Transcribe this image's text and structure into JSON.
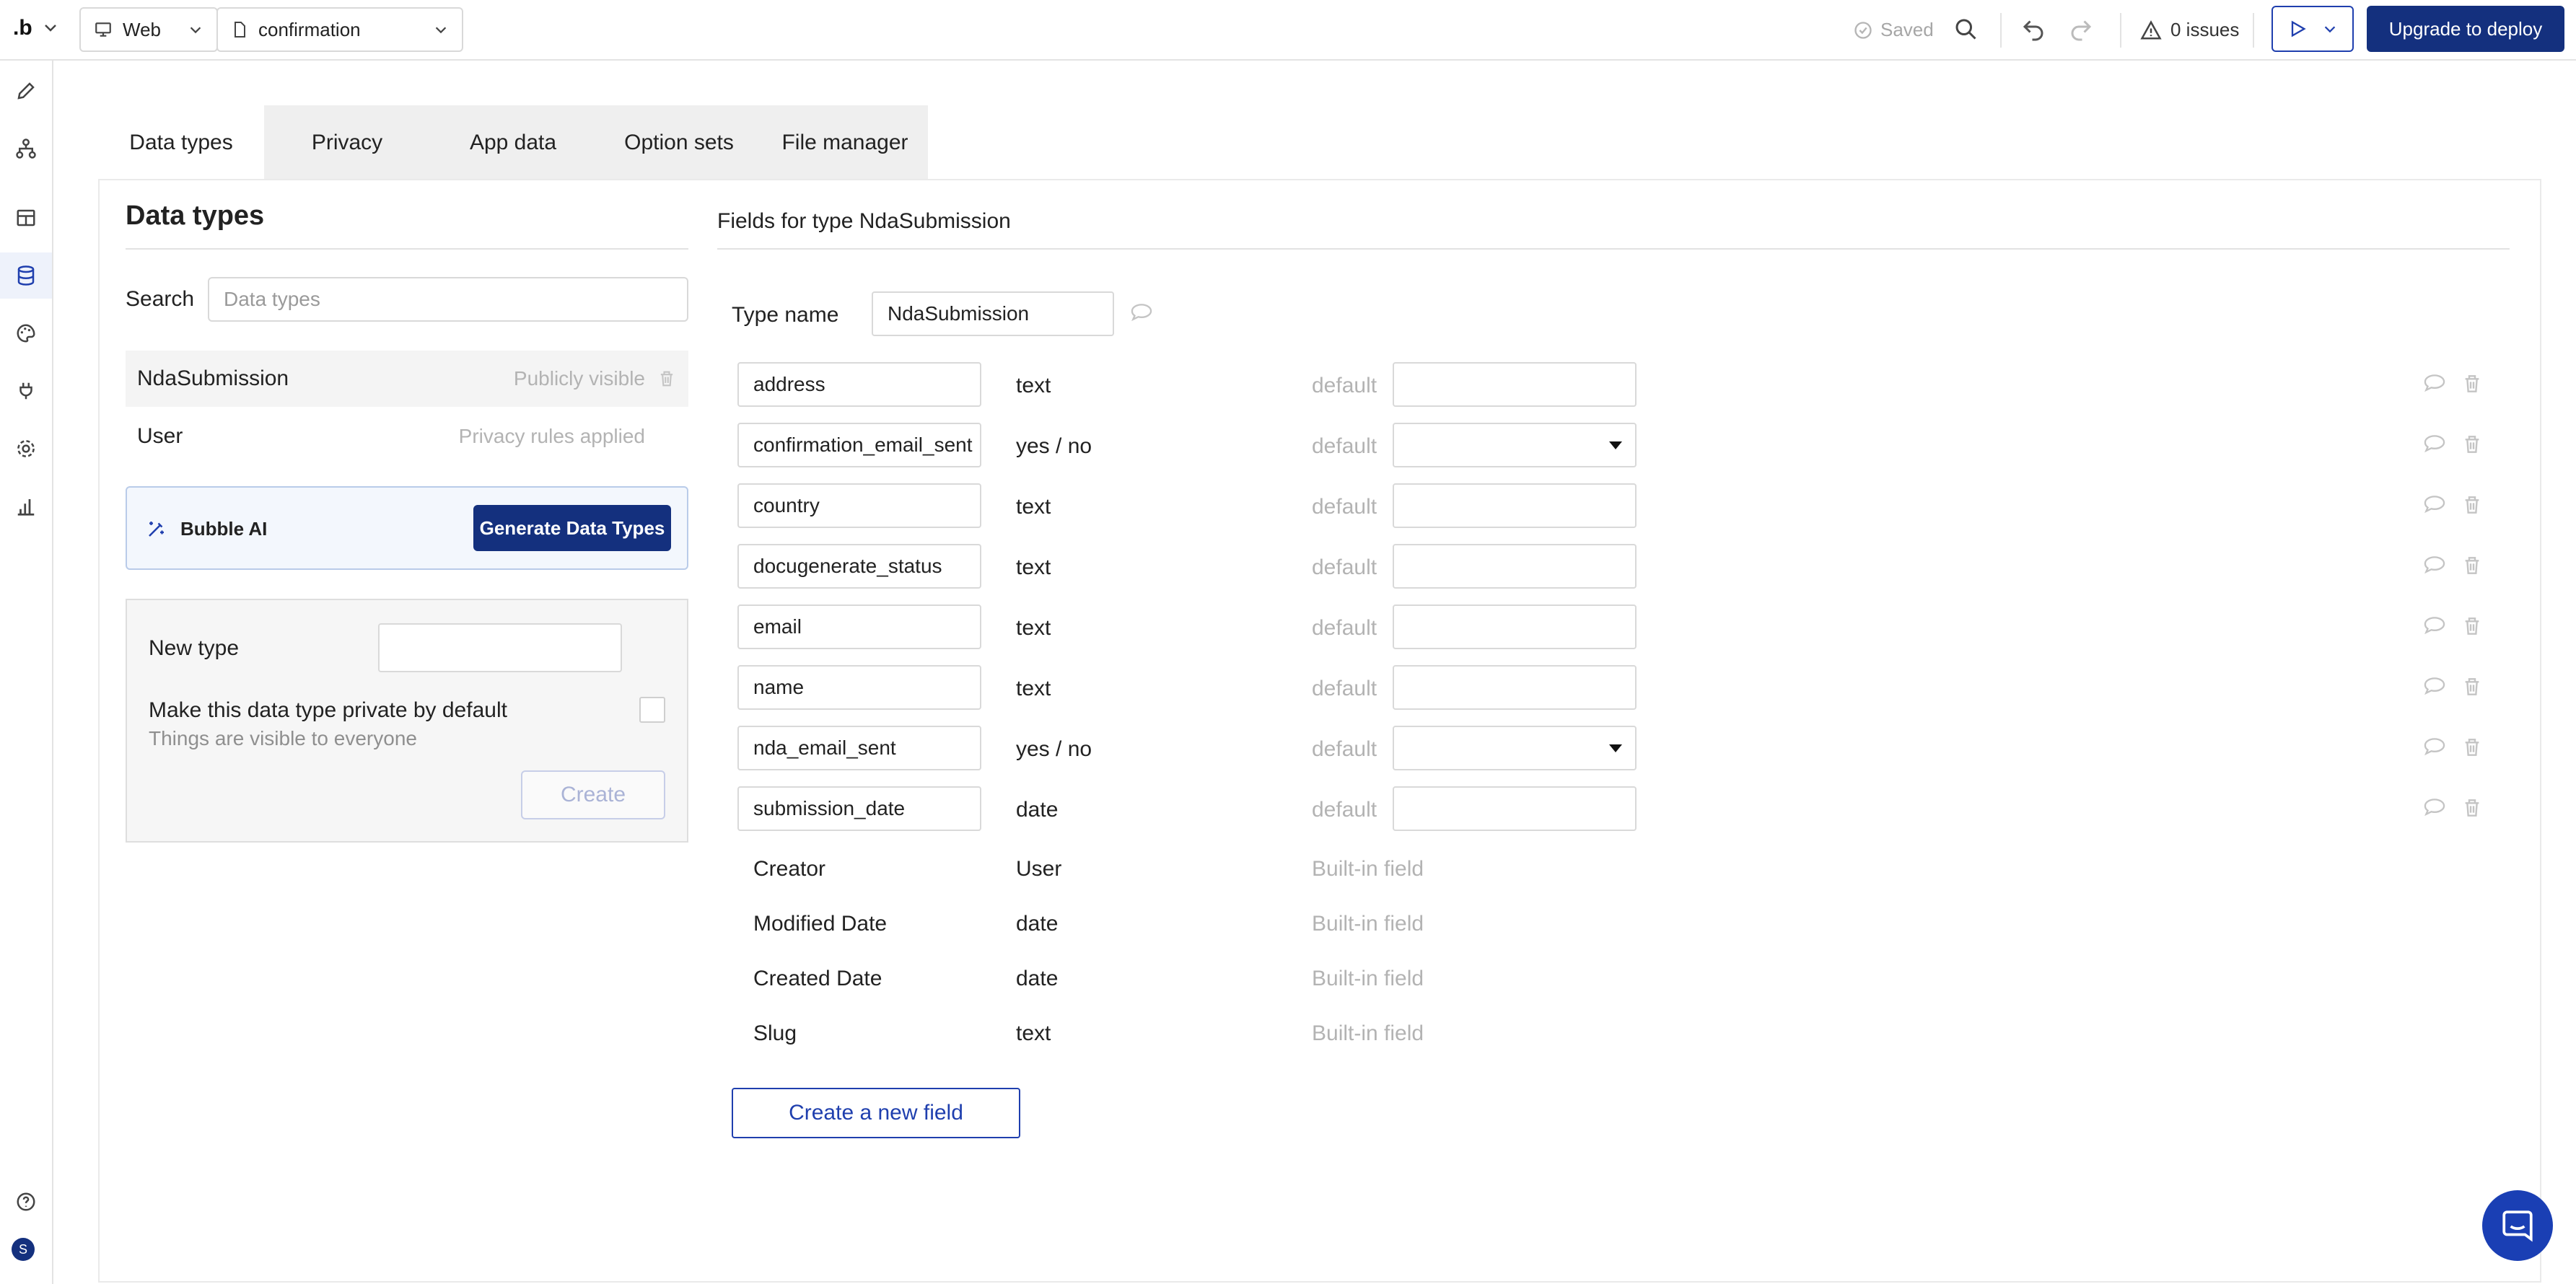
{
  "topbar": {
    "logo": ".b",
    "platform": "Web",
    "page": "confirmation",
    "saved": "Saved",
    "issues": "0 issues",
    "deploy": "Upgrade to deploy"
  },
  "tabs": [
    {
      "label": "Data types",
      "active": true
    },
    {
      "label": "Privacy"
    },
    {
      "label": "App data"
    },
    {
      "label": "Option sets"
    },
    {
      "label": "File manager"
    }
  ],
  "left": {
    "title": "Data types",
    "search_label": "Search",
    "search_placeholder": "Data types",
    "types": [
      {
        "name": "NdaSubmission",
        "visibility": "Publicly visible"
      },
      {
        "name": "User",
        "visibility": "Privacy rules applied"
      }
    ],
    "ai_label": "Bubble AI",
    "generate_label": "Generate Data Types",
    "new_type_label": "New type",
    "private_label": "Make this data type private by default",
    "visible_note": "Things are visible to everyone",
    "create_label": "Create"
  },
  "right": {
    "title": "Fields for type NdaSubmission",
    "type_name_label": "Type name",
    "type_name_value": "NdaSubmission",
    "default_label": "default",
    "fields": [
      {
        "name": "address",
        "type": "text",
        "kind": "input"
      },
      {
        "name": "confirmation_email_sent",
        "type": "yes / no",
        "kind": "select"
      },
      {
        "name": "country",
        "type": "text",
        "kind": "input"
      },
      {
        "name": "docugenerate_status",
        "type": "text",
        "kind": "input"
      },
      {
        "name": "email",
        "type": "text",
        "kind": "input"
      },
      {
        "name": "name",
        "type": "text",
        "kind": "input"
      },
      {
        "name": "nda_email_sent",
        "type": "yes / no",
        "kind": "select"
      },
      {
        "name": "submission_date",
        "type": "date",
        "kind": "input"
      }
    ],
    "builtin_note": "Built-in field",
    "builtins": [
      {
        "name": "Creator",
        "type": "User"
      },
      {
        "name": "Modified Date",
        "type": "date"
      },
      {
        "name": "Created Date",
        "type": "date"
      },
      {
        "name": "Slug",
        "type": "text"
      }
    ],
    "new_field_label": "Create a new field"
  },
  "user": {
    "initial": "S"
  },
  "colors": {
    "primary": "#14307e",
    "accent": "#1f3fae"
  }
}
